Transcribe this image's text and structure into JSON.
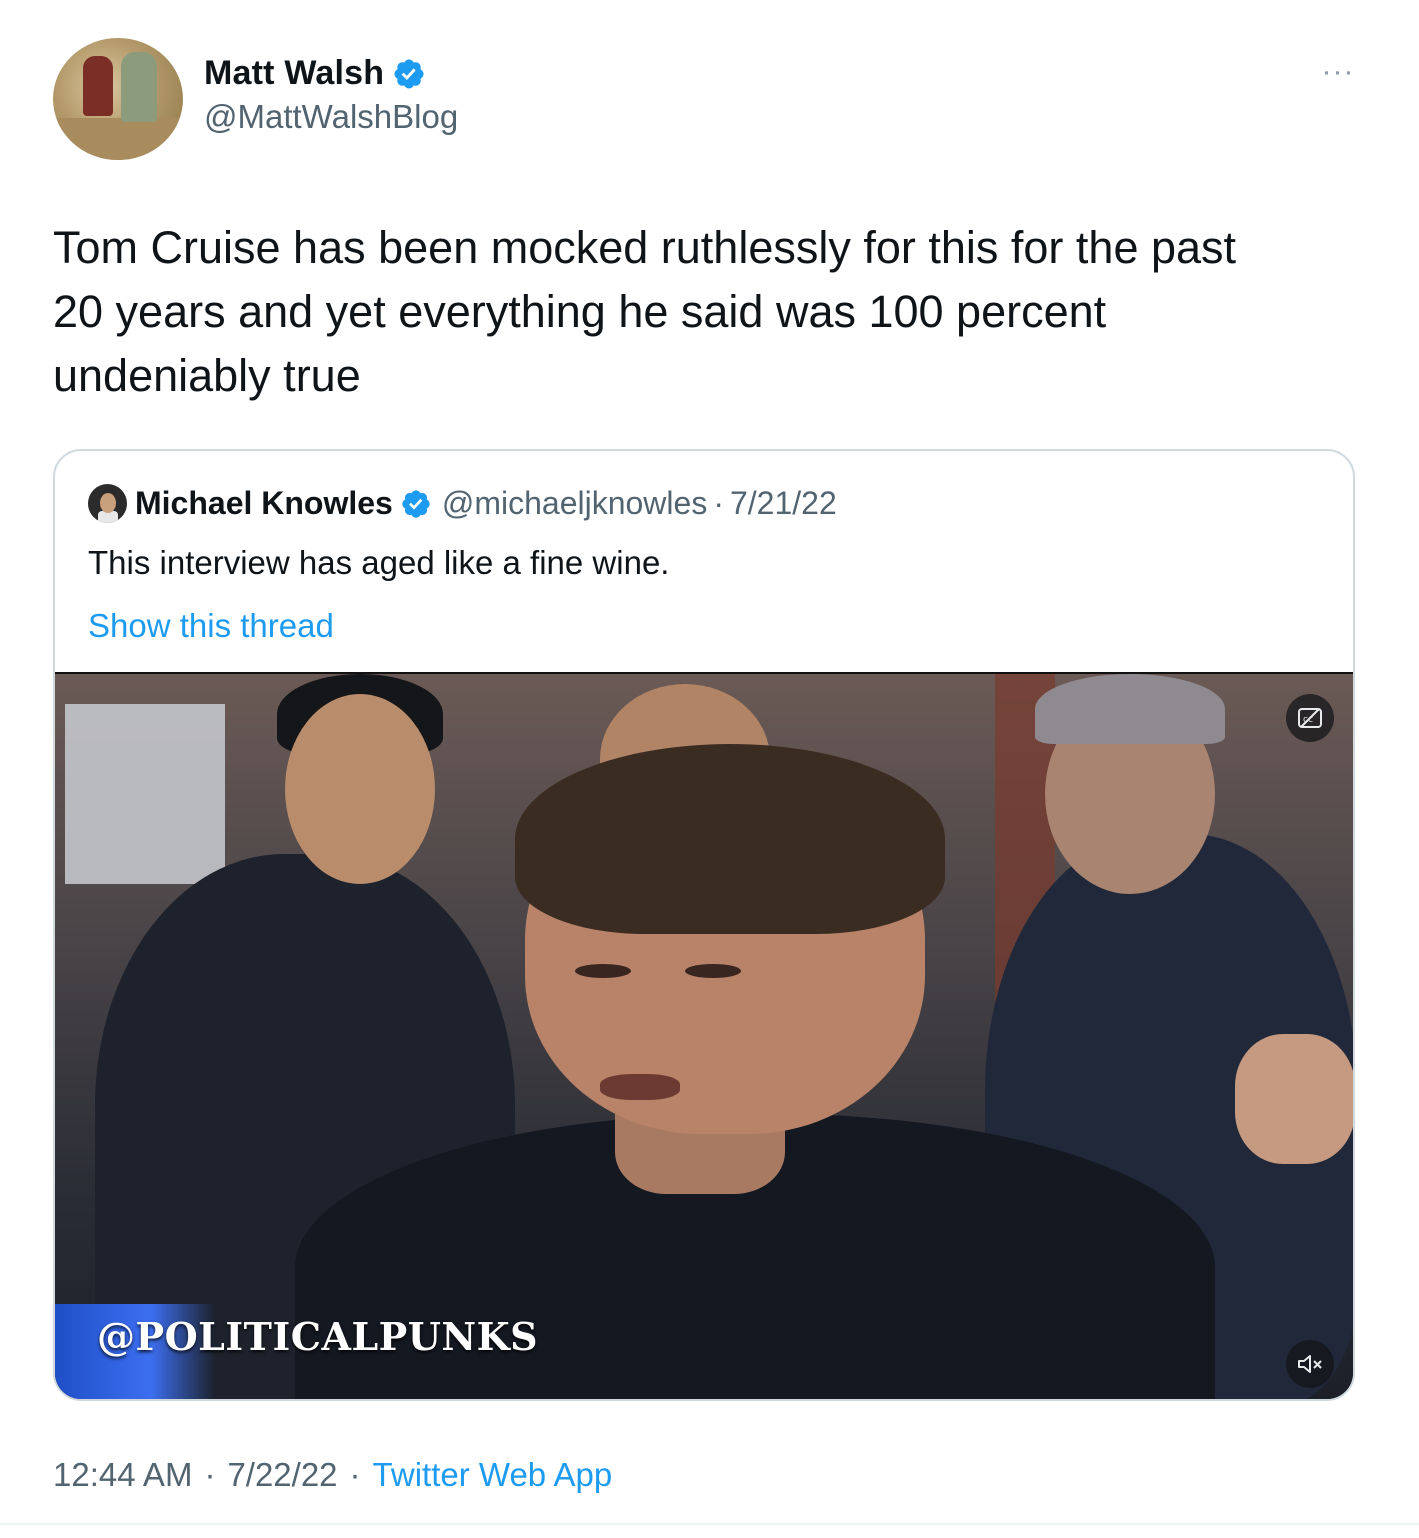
{
  "author": {
    "display_name": "Matt Walsh",
    "handle": "@MattWalshBlog",
    "verified": true
  },
  "tweet": {
    "text": "Tom Cruise has been mocked ruthlessly for this for the past\n20 years and yet everything he said was 100 percent\nundeniably true"
  },
  "quoted_tweet": {
    "display_name": "Michael Knowles",
    "handle": "@michaeljknowles",
    "separator": "·",
    "date": "7/21/22",
    "text": "This interview has aged like a fine wine.",
    "show_thread_label": "Show this thread",
    "video": {
      "watermark": "@POLITICALPUNKS",
      "captions_icon": "closed-captions-icon",
      "mute_icon": "muted-speaker-icon"
    }
  },
  "meta": {
    "time": "12:44 AM",
    "separator": "·",
    "date": "7/22/22",
    "source": "Twitter Web App"
  },
  "colors": {
    "accent": "#1d9bf0",
    "secondary_text": "#536471",
    "border": "#cfd9de"
  }
}
